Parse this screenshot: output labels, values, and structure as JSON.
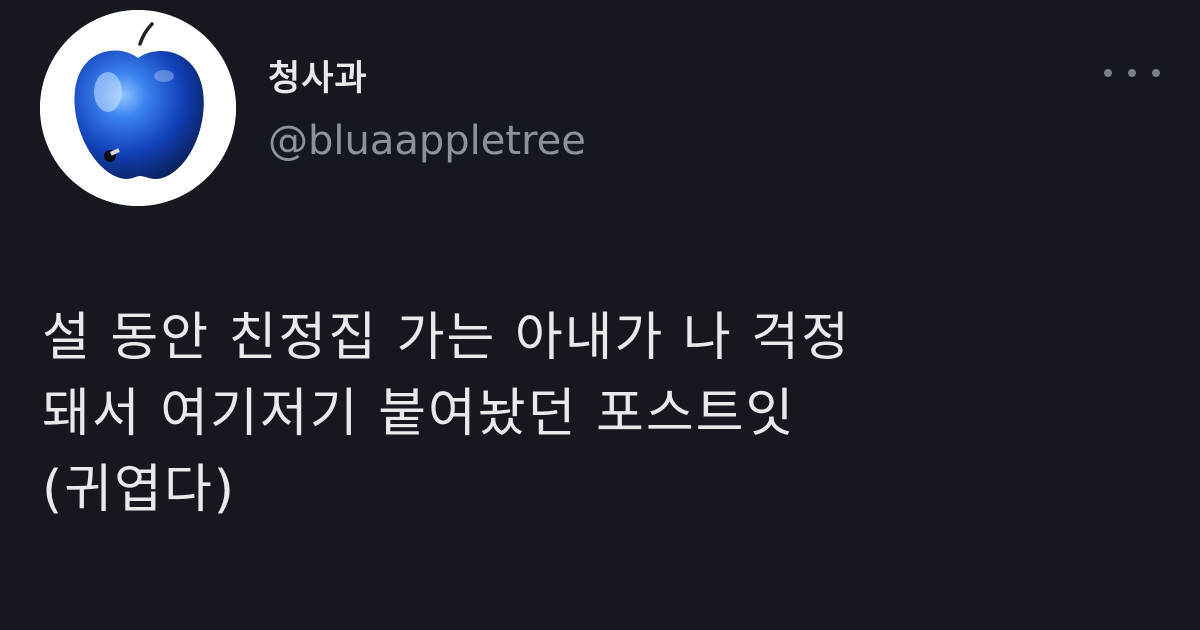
{
  "user": {
    "display_name": "청사과",
    "handle": "@bluaappletree",
    "avatar_icon": "blue-apple-icon"
  },
  "menu": {
    "more_icon": "more-options-icon"
  },
  "tweet": {
    "lines": [
      "설 동안 친정집 가는 아내가 나 걱정",
      "돼서 여기저기 붙여놨던 포스트잇",
      "(귀엽다)"
    ]
  },
  "colors": {
    "background": "#161820",
    "text": "#e7e9ea",
    "muted": "#8b949c",
    "accent": "#1f5fd6"
  }
}
